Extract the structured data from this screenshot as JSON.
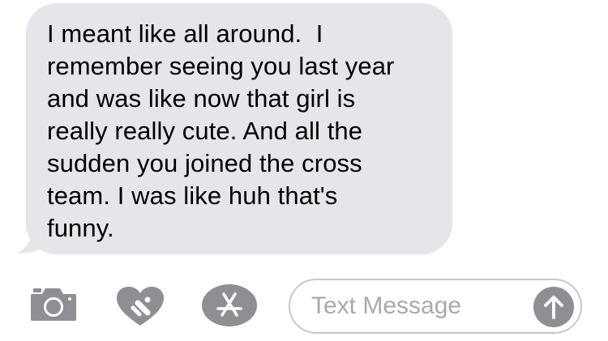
{
  "conversation": {
    "incoming_message": {
      "lines": [
        "I meant like all around.  I",
        "remember seeing you last year",
        "and was like now that girl is",
        "really really cute. And all the",
        "sudden you joined the cross",
        "team. I was like huh that's",
        "funny."
      ]
    }
  },
  "composer": {
    "placeholder": "Text Message",
    "icons": {
      "camera": "camera-icon",
      "digital_touch": "digital-touch-heart-icon",
      "app_store": "app-store-icon",
      "send": "send-arrow-up-icon"
    }
  },
  "colors": {
    "bubble_background": "#e5e5ea",
    "icon_gray": "#8e8e93",
    "placeholder_gray": "#a9a9ae",
    "field_border": "#c7c7cc"
  }
}
